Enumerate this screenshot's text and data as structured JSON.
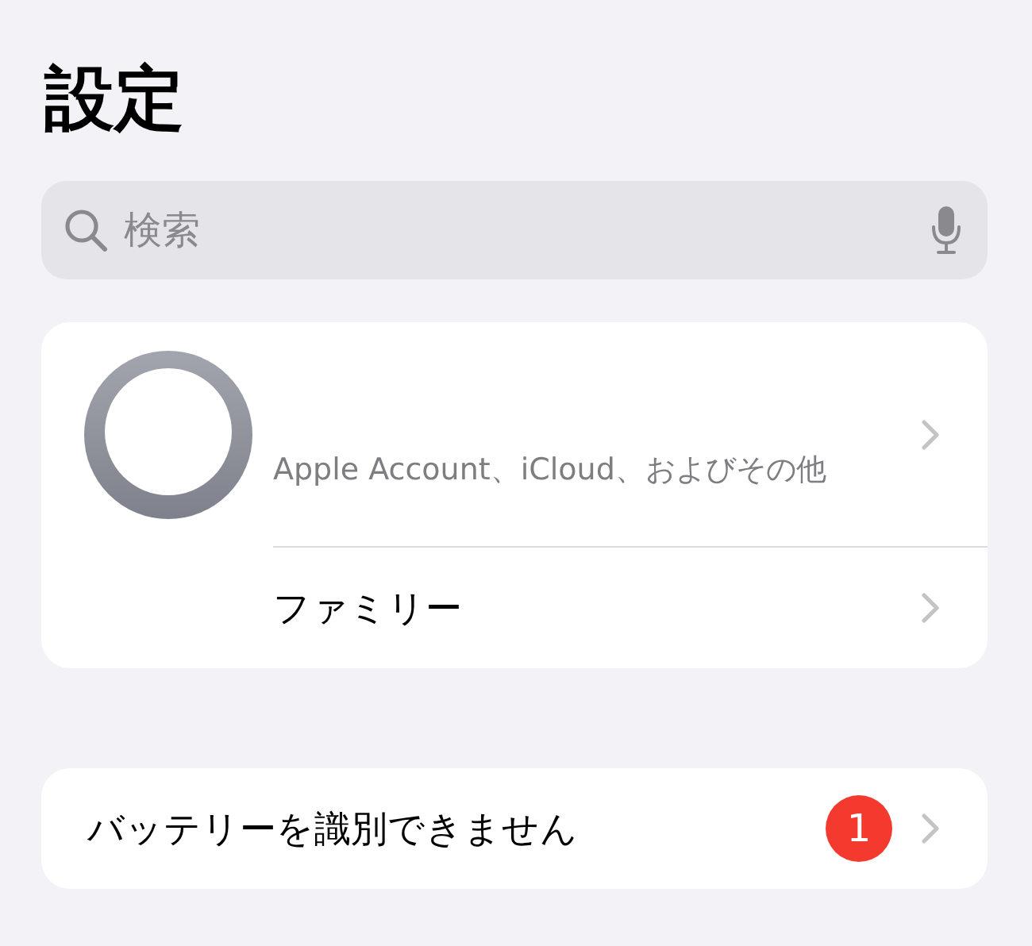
{
  "title": "設定",
  "search": {
    "placeholder": "検索"
  },
  "account": {
    "subtitle": "Apple Account、iCloud、およびその他"
  },
  "family": {
    "label": "ファミリー"
  },
  "alert": {
    "label": "バッテリーを識別できません",
    "badge": "1"
  }
}
